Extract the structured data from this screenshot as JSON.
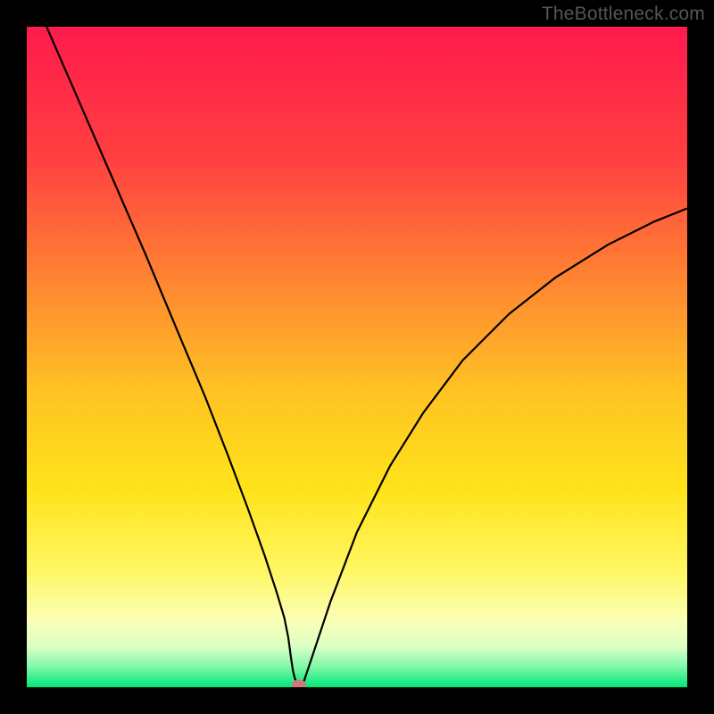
{
  "watermark": "TheBottleneck.com",
  "chart_data": {
    "type": "line",
    "title": "",
    "xlabel": "",
    "ylabel": "",
    "xlim": [
      0,
      100
    ],
    "ylim": [
      0,
      100
    ],
    "background_gradient": {
      "stops": [
        {
          "offset": 0.0,
          "color": "#ff1a4d"
        },
        {
          "offset": 0.2,
          "color": "#ff4040"
        },
        {
          "offset": 0.4,
          "color": "#ff8b30"
        },
        {
          "offset": 0.55,
          "color": "#ffc223"
        },
        {
          "offset": 0.7,
          "color": "#ffe31a"
        },
        {
          "offset": 0.82,
          "color": "#fff660"
        },
        {
          "offset": 0.9,
          "color": "#fbffb8"
        },
        {
          "offset": 0.94,
          "color": "#d9ffc4"
        },
        {
          "offset": 0.97,
          "color": "#7cf7a8"
        },
        {
          "offset": 1.0,
          "color": "#00e676"
        }
      ]
    },
    "series": [
      {
        "name": "bottleneck-curve",
        "color": "#000000",
        "width": 2.2,
        "x": [
          3.0,
          8.0,
          13.0,
          18.0,
          23.0,
          27.0,
          30.5,
          33.5,
          36.0,
          37.8,
          39.0,
          39.6,
          40.0,
          40.3,
          40.6,
          41.0,
          41.4,
          42.0,
          43.5,
          46.0,
          50.0,
          55.0,
          60.0,
          66.0,
          73.0,
          80.0,
          88.0,
          95.0,
          100.0
        ],
        "y": [
          100.0,
          88.5,
          77.0,
          65.5,
          53.5,
          44.0,
          35.0,
          27.0,
          20.0,
          14.5,
          10.5,
          7.5,
          4.5,
          2.5,
          1.3,
          0.4,
          0.2,
          1.0,
          5.5,
          13.0,
          23.5,
          33.5,
          41.5,
          49.5,
          56.5,
          62.0,
          67.0,
          70.5,
          72.5
        ]
      }
    ],
    "marker": {
      "name": "optimal-point",
      "x": 41.2,
      "y": 0.35,
      "rx": 1.1,
      "ry": 0.8,
      "color": "#cf7a78"
    }
  }
}
